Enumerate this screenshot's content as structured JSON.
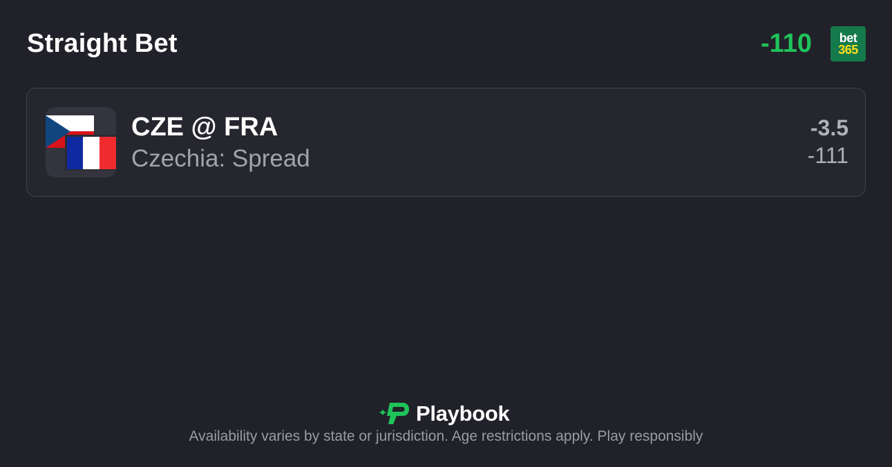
{
  "header": {
    "title": "Straight Bet",
    "odds": "-110",
    "odds_color": "#1fc35a",
    "sportsbook": {
      "line1": "bet",
      "line2": "365",
      "bg_color": "#157a4b",
      "accent_color": "#ffdf1b"
    }
  },
  "bet": {
    "matchup": "CZE @ FRA",
    "selection": "Czechia: Spread",
    "line": "-3.5",
    "price": "-111",
    "away_flag_icon": "czech-flag-icon",
    "home_flag_icon": "france-flag-icon"
  },
  "footer": {
    "brand": "Playbook",
    "brand_color": "#1fc35a",
    "disclaimer": "Availability varies by state or jurisdiction. Age restrictions apply. Play responsibly"
  }
}
